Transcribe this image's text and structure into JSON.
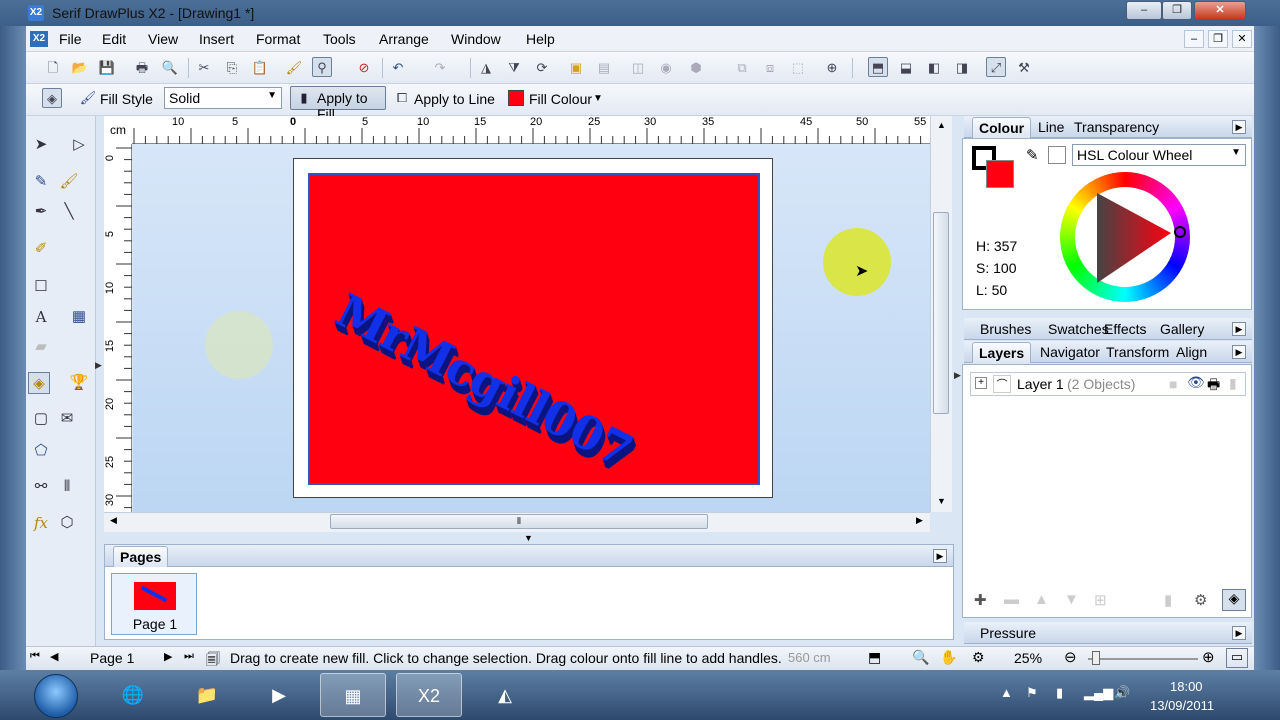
{
  "window": {
    "title": "Serif DrawPlus X2 - [Drawing1 *]",
    "minimize": "–",
    "maximize": "❐",
    "close": "✕"
  },
  "menu": {
    "items": [
      "File",
      "Edit",
      "View",
      "Insert",
      "Format",
      "Tools",
      "Arrange",
      "Window",
      "Help"
    ],
    "mdi_minimize": "–",
    "mdi_restore": "❐",
    "mdi_close": "✕"
  },
  "context_toolbar": {
    "fill_style_label": "Fill Style",
    "fill_style_value": "Solid",
    "apply_to_fill": "Apply to Fill",
    "apply_to_line": "Apply to Line",
    "fill_colour": "Fill Colour",
    "fill_colour_swatch": "#ff0010"
  },
  "ruler": {
    "unit": "cm",
    "h_ticks": [
      "10",
      "5",
      "0",
      "5",
      "10",
      "15",
      "20",
      "25",
      "30",
      "35",
      "45",
      "50",
      "55"
    ],
    "v_ticks": [
      "0",
      "5",
      "10",
      "15",
      "20",
      "25",
      "30"
    ]
  },
  "canvas": {
    "art_text": "MrMcgill007",
    "rect_fill": "#ff0010",
    "text_color": "#1230e8"
  },
  "pages_panel": {
    "title": "Pages",
    "page_label": "Page 1"
  },
  "colour_panel": {
    "tabs": [
      "Colour",
      "Line",
      "Transparency"
    ],
    "model": "HSL Colour Wheel",
    "h": "H: 357",
    "s": "S: 100",
    "l": "L: 50",
    "current_colour": "#ff0010"
  },
  "tab_group_2": {
    "tabs": [
      "Brushes",
      "Swatches",
      "Effects",
      "Gallery"
    ]
  },
  "layers_panel": {
    "tabs": [
      "Layers",
      "Navigator",
      "Transform",
      "Align"
    ],
    "layer_name": "Layer 1",
    "layer_count": "(2 Objects)"
  },
  "pressure_panel": {
    "title": "Pressure"
  },
  "statusbar": {
    "page": "Page 1",
    "hint": "Drag to create new fill. Click to change selection. Drag colour onto fill line to add handles.",
    "coords": "560 cm",
    "zoom": "25%"
  },
  "taskbar": {
    "time": "18:00",
    "date": "13/09/2011"
  }
}
